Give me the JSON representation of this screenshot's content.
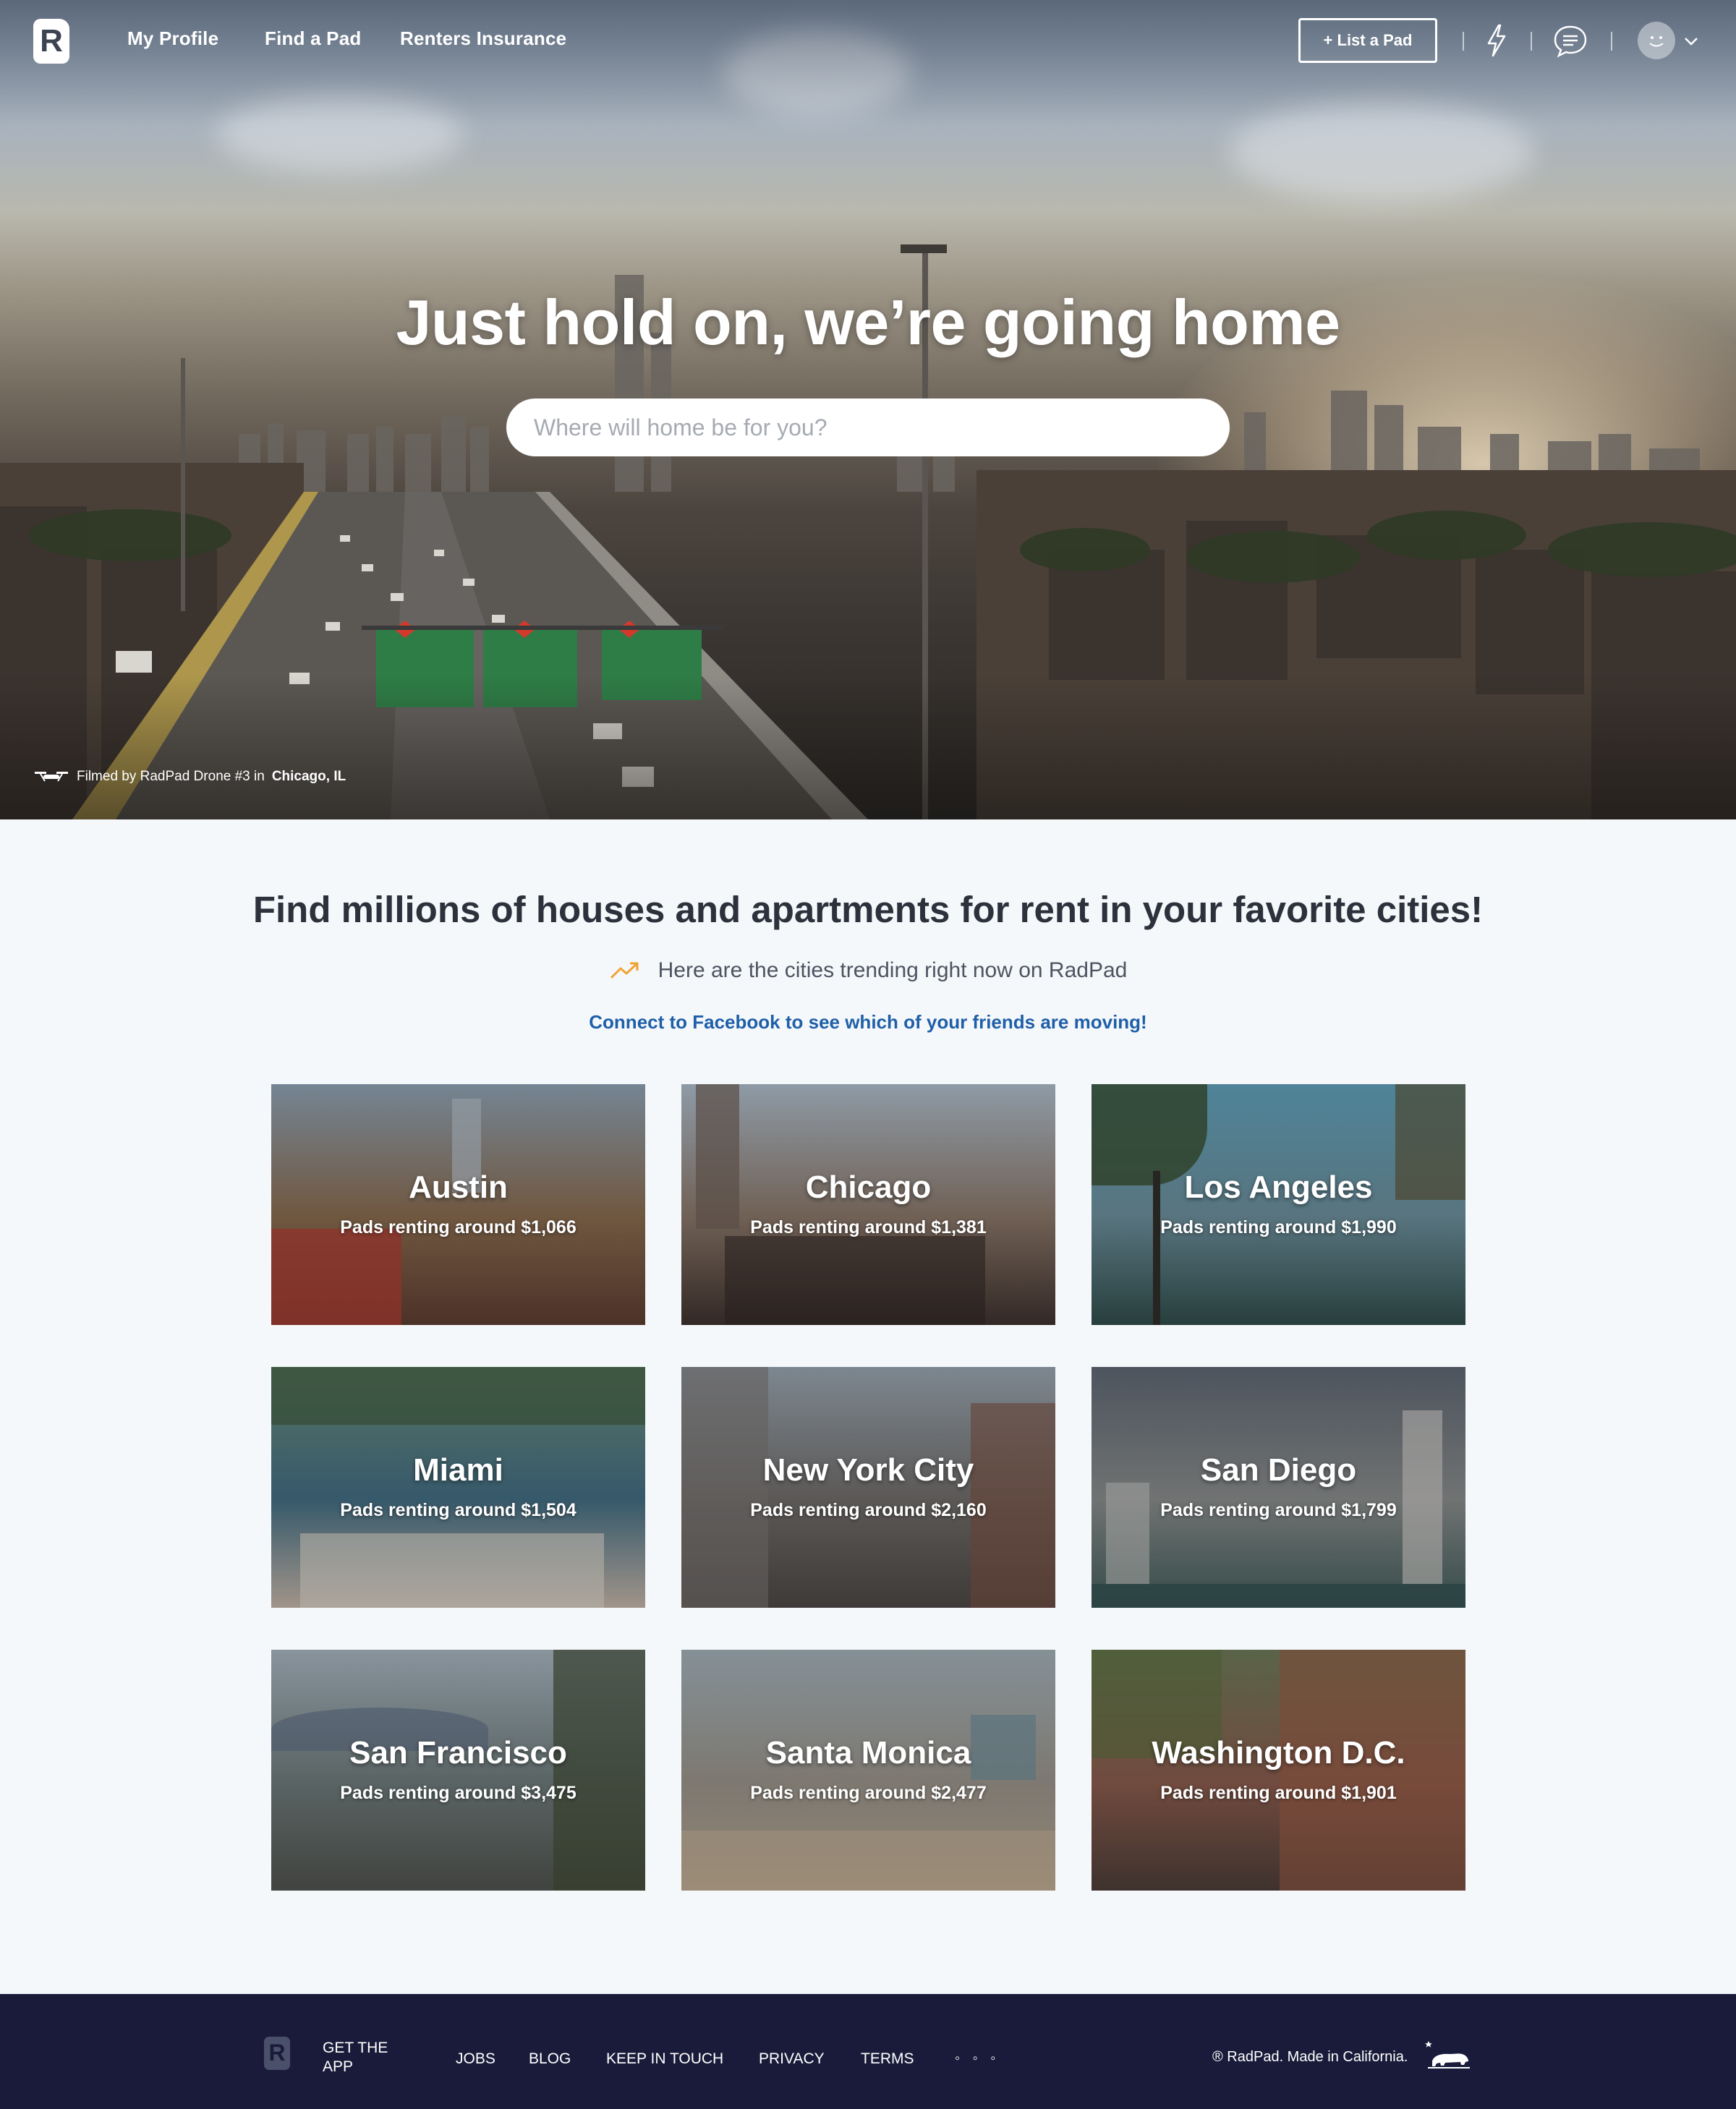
{
  "nav": {
    "logo": "R",
    "links": [
      "My Profile",
      "Find a Pad",
      "Renters Insurance"
    ],
    "list_pad": "+ List a Pad",
    "icons": [
      "lightning-icon",
      "chat-icon",
      "avatar-icon",
      "chevron-down-icon"
    ]
  },
  "hero": {
    "title": "Just hold on, we’re going home",
    "search_placeholder": "Where will home be for you?",
    "credit_prefix": "Filmed by RadPad Drone #3 in",
    "credit_location": "Chicago, IL"
  },
  "main": {
    "headline": "Find millions of houses and apartments for rent in your favorite cities!",
    "trending": "Here are the cities trending right now on RadPad",
    "facebook_link": "Connect to Facebook to see which of your friends are moving!"
  },
  "cities": [
    {
      "name": "Austin",
      "price": "Pads renting around $1,066",
      "bg": [
        "#8fa4b4",
        "#8a6a4a",
        "#5b3a2a"
      ]
    },
    {
      "name": "Chicago",
      "price": "Pads renting around $1,381",
      "bg": [
        "#b0c0cc",
        "#8a7665",
        "#3b2e27"
      ]
    },
    {
      "name": "Los Angeles",
      "price": "Pads renting around $1,990",
      "bg": [
        "#5fa3bb",
        "#6b8f9a",
        "#2c4a45"
      ]
    },
    {
      "name": "Miami",
      "price": "Pads renting around $1,504",
      "bg": [
        "#6b8e7a",
        "#3f6c80",
        "#c8b8a8"
      ]
    },
    {
      "name": "New York City",
      "price": "Pads renting around $2,160",
      "bg": [
        "#9aa7b0",
        "#6f6b66",
        "#4a4540"
      ]
    },
    {
      "name": "San Diego",
      "price": "Pads renting around $1,799",
      "bg": [
        "#5d6670",
        "#8a8d8a",
        "#3e5a55"
      ]
    },
    {
      "name": "San Francisco",
      "price": "Pads renting around $3,475",
      "bg": [
        "#a9b8c0",
        "#6d7a78",
        "#4d5048"
      ]
    },
    {
      "name": "Santa Monica",
      "price": "Pads renting around $2,477",
      "bg": [
        "#a4b3b8",
        "#9a9488",
        "#b8a58a"
      ]
    },
    {
      "name": "Washington D.C.",
      "price": "Pads renting around $1,901",
      "bg": [
        "#6d7a55",
        "#8b5a48",
        "#4a3a32"
      ]
    }
  ],
  "footer": {
    "logo": "R",
    "get_app": [
      "GET THE",
      "APP"
    ],
    "links": [
      "JOBS",
      "BLOG",
      "KEEP IN TOUCH",
      "PRIVACY",
      "TERMS"
    ],
    "more": "◦ ◦ ◦",
    "copyright": "® RadPad. Made in California."
  },
  "colors": {
    "footer_bg": "#1a1b3a",
    "link_blue": "#1f5fa8",
    "trend_orange": "#f0a332",
    "page_bg": "#f5f8fb"
  }
}
